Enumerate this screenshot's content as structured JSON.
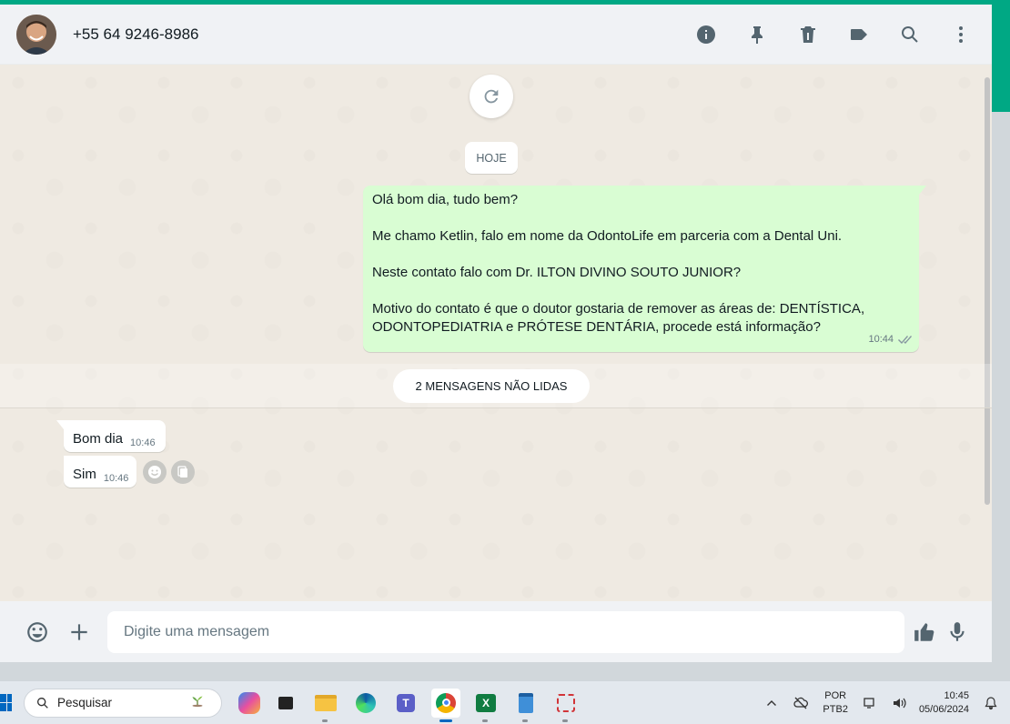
{
  "header": {
    "contact_name": "+55 64 9246-8986",
    "icons": [
      "info-icon",
      "pin-icon",
      "delete-icon",
      "label-icon",
      "search-icon",
      "menu-icon"
    ]
  },
  "chat": {
    "date_chip": "HOJE",
    "outgoing": {
      "paragraphs": [
        "Olá bom dia, tudo bem?",
        "Me chamo Ketlin, falo em nome da OdontoLife em parceria com a Dental Uni.",
        "Neste contato falo com Dr. ILTON DIVINO SOUTO JUNIOR?",
        "Motivo do contato é que o doutor gostaria de remover as áreas de: DENTÍSTICA, ODONTOPEDIATRIA e PRÓTESE DENTÁRIA, procede está informação?"
      ],
      "time": "10:44",
      "status": "delivered-double-check"
    },
    "unread_label": "2 MENSAGENS NÃO LIDAS",
    "incoming": [
      {
        "text": "Bom dia",
        "time": "10:46"
      },
      {
        "text": "Sim",
        "time": "10:46"
      }
    ]
  },
  "footer": {
    "placeholder": "Digite uma mensagem"
  },
  "taskbar": {
    "search_label": "Pesquisar",
    "apps": [
      "copilot-app",
      "task-view-app",
      "file-explorer-app",
      "edge-app",
      "teams-app",
      "chrome-app",
      "excel-app",
      "notepad-app",
      "snipping-tool-app"
    ],
    "active_app": "chrome-app",
    "lang_line1": "POR",
    "lang_line2": "PTB2",
    "time": "10:45",
    "date": "05/06/2024"
  },
  "colors": {
    "accent": "#00a884",
    "outgoing_bubble": "#d9fdd3",
    "chat_background": "#efeae2"
  }
}
